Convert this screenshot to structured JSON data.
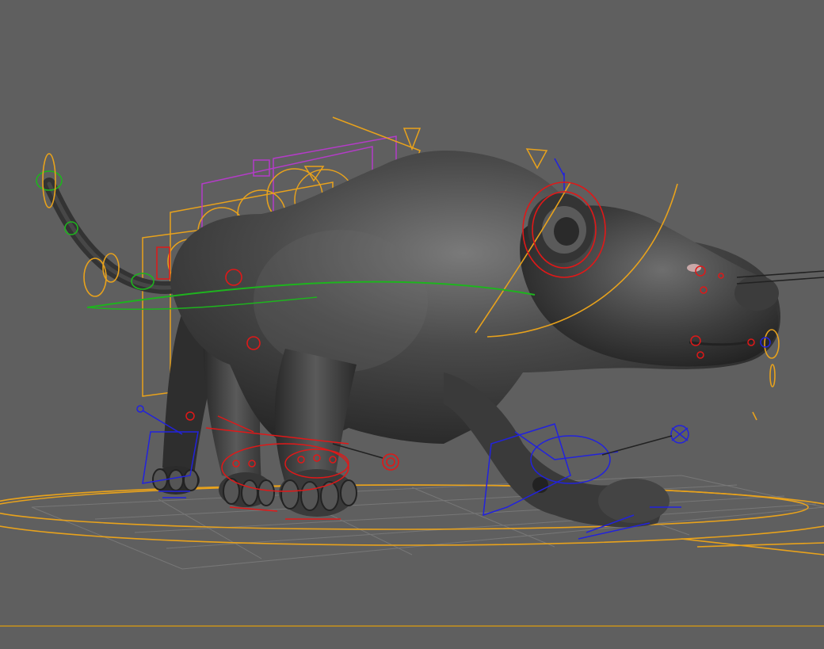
{
  "viewport": {
    "background": "#5f5f5f",
    "colors": {
      "body": "#3a3a3a",
      "body_highlight": "#767676",
      "grid": "#808080",
      "ctl_yellow": "#e8a21c",
      "ctl_red": "#e01818",
      "ctl_blue": "#2222dd",
      "ctl_green": "#1eb41e",
      "ctl_magenta": "#b43cc8",
      "ground_line": "#c8921c"
    },
    "icons": [
      "tail-ik-ring",
      "spine-box-controls",
      "leg-ik-handles",
      "head-curve",
      "pole-vector-target"
    ]
  }
}
